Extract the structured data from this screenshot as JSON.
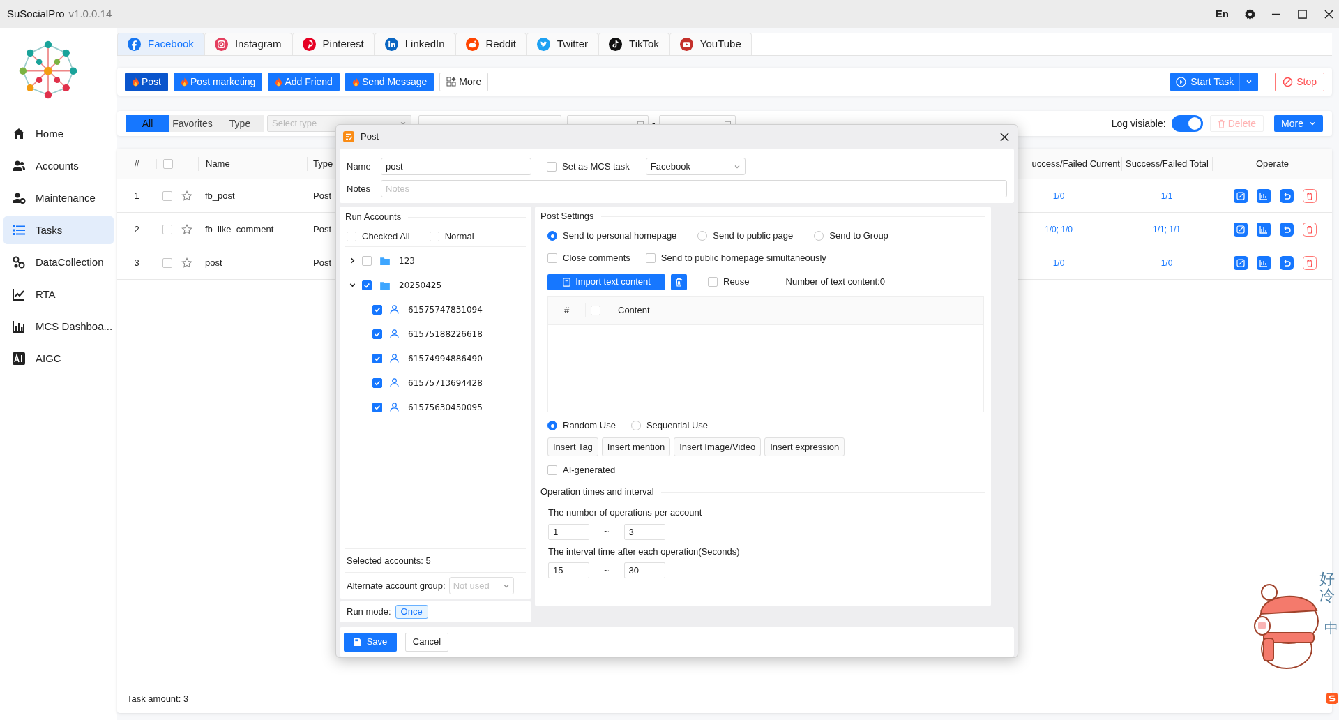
{
  "app": {
    "title": "SuSocialPro",
    "version": "v1.0.0.14",
    "language": "En"
  },
  "sidebar": {
    "items": [
      {
        "label": "Home",
        "selected": false
      },
      {
        "label": "Accounts",
        "selected": false
      },
      {
        "label": "Maintenance",
        "selected": false
      },
      {
        "label": "Tasks",
        "selected": true
      },
      {
        "label": "DataCollection",
        "selected": false
      },
      {
        "label": "RTA",
        "selected": false
      },
      {
        "label": "MCS Dashboa...",
        "selected": false
      },
      {
        "label": "AIGC",
        "selected": false
      }
    ]
  },
  "platform_tabs": [
    {
      "label": "Facebook",
      "selected": true
    },
    {
      "label": "Instagram",
      "selected": false
    },
    {
      "label": "Pinterest",
      "selected": false
    },
    {
      "label": "LinkedIn",
      "selected": false
    },
    {
      "label": "Reddit",
      "selected": false
    },
    {
      "label": "Twitter",
      "selected": false
    },
    {
      "label": "TikTok",
      "selected": false
    },
    {
      "label": "YouTube",
      "selected": false
    }
  ],
  "toolbar": {
    "actions": [
      {
        "label": "Post",
        "kind": "hot",
        "selected": true
      },
      {
        "label": "Post marketing",
        "kind": "hot",
        "selected": false
      },
      {
        "label": "Add Friend",
        "kind": "hot",
        "selected": false
      },
      {
        "label": "Send Message",
        "kind": "hot",
        "selected": false
      },
      {
        "label": "More",
        "kind": "more",
        "selected": false
      }
    ],
    "start_task": "Start Task",
    "stop": "Stop"
  },
  "filter": {
    "views": [
      {
        "label": "All",
        "selected": true
      },
      {
        "label": "Favorites",
        "selected": false
      },
      {
        "label": "Type",
        "selected": false
      }
    ],
    "type_placeholder": "Select type",
    "separator": "-",
    "log_label": "Log visiable:",
    "log_visible": true,
    "delete": {
      "label": "Delete",
      "disabled": true
    },
    "more": "More"
  },
  "table": {
    "all_checked": false,
    "columns": [
      "#",
      "Name",
      "Type",
      "uccess/Failed Current",
      "Success/Failed Total",
      "Operate"
    ],
    "rows": [
      {
        "index": "1",
        "checked": false,
        "favorite": false,
        "name": "fb_post",
        "type": "Post",
        "current": "1/0",
        "total": "1/1"
      },
      {
        "index": "2",
        "checked": false,
        "favorite": false,
        "name": "fb_like_comment",
        "type": "Post",
        "current": "1/0; 1/0",
        "total": "1/1; 1/1"
      },
      {
        "index": "3",
        "checked": false,
        "favorite": false,
        "name": "post",
        "type": "Post",
        "current": "1/0",
        "total": "1/0"
      }
    ]
  },
  "footer": {
    "task_amount": "Task amount: 3"
  },
  "dialog": {
    "title": "Post",
    "name_label": "Name",
    "name_value": "post",
    "mcs": {
      "label": "Set as MCS task",
      "checked": false
    },
    "platform": "Facebook",
    "notes_label": "Notes",
    "notes_placeholder": "Notes",
    "run_accounts": {
      "title": "Run Accounts",
      "checked_all": {
        "label": "Checked All",
        "checked": false
      },
      "normal": {
        "label": "Normal",
        "checked": false
      },
      "groups": [
        {
          "label": "123",
          "expanded": false,
          "checked": false
        },
        {
          "label": "20250425",
          "expanded": true,
          "checked": true,
          "children": [
            {
              "label": "61575747831094",
              "checked": true
            },
            {
              "label": "61575188226618",
              "checked": true
            },
            {
              "label": "61574994886490",
              "checked": true
            },
            {
              "label": "61575713694428",
              "checked": true
            },
            {
              "label": "61575630450095",
              "checked": true
            }
          ]
        }
      ],
      "selected_count": "Selected accounts: 5",
      "alternate_label": "Alternate account group:",
      "alternate_placeholder": "Not used"
    },
    "run_mode": {
      "label": "Run mode:",
      "value": "Once"
    },
    "post_settings": {
      "title": "Post Settings",
      "targets": [
        {
          "label": "Send to personal homepage",
          "selected": true
        },
        {
          "label": "Send to public page",
          "selected": false
        },
        {
          "label": "Send to Group",
          "selected": false
        }
      ],
      "options": [
        {
          "label": "Close comments",
          "checked": false
        },
        {
          "label": "Send to public homepage simultaneously",
          "checked": false
        }
      ],
      "import_button": "Import text content",
      "reuse": {
        "label": "Reuse",
        "checked": false
      },
      "content_count": "Number of text content:0",
      "content_columns": [
        "#",
        "Content"
      ],
      "content_all_checked": false,
      "use_modes": [
        {
          "label": "Random Use",
          "selected": true
        },
        {
          "label": "Sequential Use",
          "selected": false
        }
      ],
      "insert_buttons": [
        "Insert Tag",
        "Insert mention",
        "Insert Image/Video",
        "Insert expression"
      ],
      "ai_generated": {
        "label": "AI-generated",
        "checked": false
      }
    },
    "operation": {
      "title": "Operation times and interval",
      "groups": [
        {
          "label": "The number of operations per account",
          "from": "1",
          "separator": "~",
          "to": "3"
        },
        {
          "label": "The interval time after each operation(Seconds)",
          "from": "15",
          "separator": "~",
          "to": "30"
        }
      ]
    },
    "save": "Save",
    "cancel": "Cancel"
  },
  "ime": {
    "sticker_text": "好冷",
    "mode": "中"
  }
}
